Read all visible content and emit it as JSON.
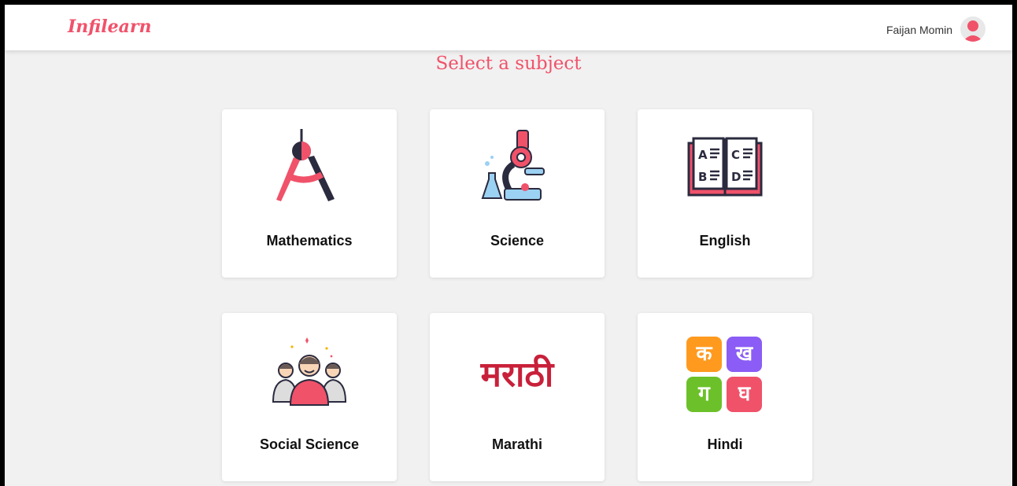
{
  "navbar": {
    "brand": "Infilearn",
    "user_name": "Faijan Momin"
  },
  "page": {
    "title": "Select a subject"
  },
  "subjects": [
    {
      "label": "Mathematics",
      "icon": "compass-icon"
    },
    {
      "label": "Science",
      "icon": "microscope-icon"
    },
    {
      "label": "English",
      "icon": "book-icon"
    },
    {
      "label": "Social Science",
      "icon": "people-icon"
    },
    {
      "label": "Marathi",
      "icon": "marathi-script-icon",
      "glyph": "मराठी"
    },
    {
      "label": "Hindi",
      "icon": "hindi-letters-icon",
      "letters": [
        "क",
        "ख",
        "ग",
        "घ"
      ]
    }
  ],
  "english_letters": [
    "A",
    "B",
    "C",
    "D"
  ],
  "colors": {
    "brand": "#f0526a",
    "background": "#f1f1f1",
    "card": "#ffffff"
  }
}
